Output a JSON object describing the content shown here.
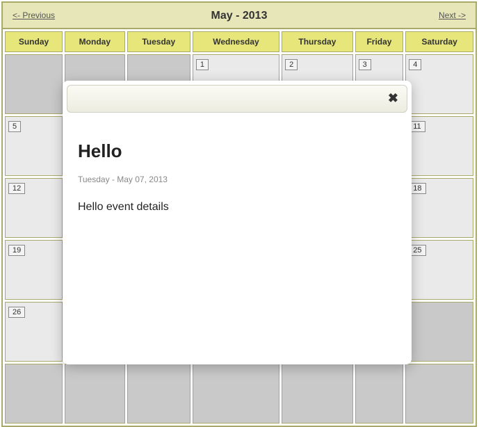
{
  "header": {
    "prev_label": "<- Previous",
    "next_label": "Next ->",
    "title": "May - 2013"
  },
  "dayheads": [
    "Sunday",
    "Monday",
    "Tuesday",
    "Wednesday",
    "Thursday",
    "Friday",
    "Saturday"
  ],
  "weeks": [
    [
      {
        "num": "",
        "type": "out"
      },
      {
        "num": "",
        "type": "out"
      },
      {
        "num": "",
        "type": "out"
      },
      {
        "num": "1",
        "type": "in"
      },
      {
        "num": "2",
        "type": "in"
      },
      {
        "num": "3",
        "type": "in"
      },
      {
        "num": "4",
        "type": "in"
      }
    ],
    [
      {
        "num": "5",
        "type": "in"
      },
      {
        "num": "",
        "type": "in"
      },
      {
        "num": "",
        "type": "in"
      },
      {
        "num": "",
        "type": "in"
      },
      {
        "num": "",
        "type": "in"
      },
      {
        "num": "",
        "type": "in"
      },
      {
        "num": "11",
        "type": "in"
      }
    ],
    [
      {
        "num": "12",
        "type": "in"
      },
      {
        "num": "",
        "type": "in"
      },
      {
        "num": "",
        "type": "in"
      },
      {
        "num": "",
        "type": "in"
      },
      {
        "num": "",
        "type": "in"
      },
      {
        "num": "",
        "type": "in"
      },
      {
        "num": "18",
        "type": "in"
      }
    ],
    [
      {
        "num": "19",
        "type": "in"
      },
      {
        "num": "",
        "type": "in"
      },
      {
        "num": "",
        "type": "in"
      },
      {
        "num": "",
        "type": "in"
      },
      {
        "num": "",
        "type": "in"
      },
      {
        "num": "",
        "type": "in"
      },
      {
        "num": "25",
        "type": "in"
      }
    ],
    [
      {
        "num": "26",
        "type": "in"
      },
      {
        "num": "",
        "type": "in"
      },
      {
        "num": "",
        "type": "in"
      },
      {
        "num": "",
        "type": "in"
      },
      {
        "num": "",
        "type": "in"
      },
      {
        "num": "",
        "type": "out"
      },
      {
        "num": "",
        "type": "out"
      }
    ],
    [
      {
        "num": "",
        "type": "out"
      },
      {
        "num": "",
        "type": "out"
      },
      {
        "num": "",
        "type": "out"
      },
      {
        "num": "",
        "type": "out"
      },
      {
        "num": "",
        "type": "out"
      },
      {
        "num": "",
        "type": "out"
      },
      {
        "num": "",
        "type": "out"
      }
    ]
  ],
  "modal": {
    "close_glyph": "✖",
    "heading": "Hello",
    "date": "Tuesday - May 07, 2013",
    "details": "Hello event details"
  }
}
